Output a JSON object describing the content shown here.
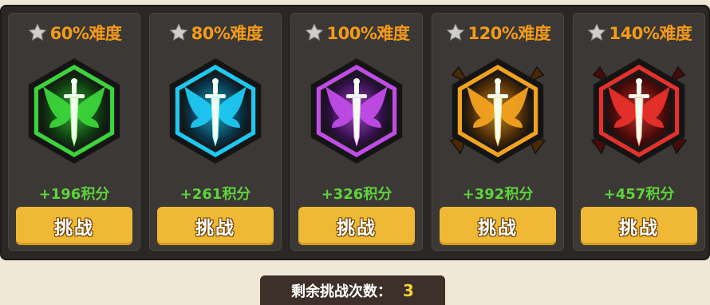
{
  "cards": [
    {
      "difficulty": "60%难度",
      "points": "+196积分",
      "button": "挑战",
      "icon": "sword-wings-icon",
      "color": "#3bd43a",
      "dark": "#0e3a10",
      "glow": "#9df07a"
    },
    {
      "difficulty": "80%难度",
      "points": "+261积分",
      "button": "挑战",
      "icon": "sword-wings-icon",
      "color": "#1fc8f2",
      "dark": "#073447",
      "glow": "#8ef0ff"
    },
    {
      "difficulty": "100%难度",
      "points": "+326积分",
      "button": "挑战",
      "icon": "sword-wings-icon",
      "color": "#c04ce8",
      "dark": "#33104a",
      "glow": "#f0a8ff"
    },
    {
      "difficulty": "120%难度",
      "points": "+392积分",
      "button": "挑战",
      "icon": "sword-wings-icon",
      "color": "#f2a21f",
      "dark": "#4a2a06",
      "glow": "#ffe07a"
    },
    {
      "difficulty": "140%难度",
      "points": "+457积分",
      "button": "挑战",
      "icon": "sword-wings-icon",
      "color": "#e8302a",
      "dark": "#4a0a0a",
      "glow": "#ff9a86"
    }
  ],
  "remaining": {
    "label": "剩余挑战次数：",
    "count": "3"
  }
}
